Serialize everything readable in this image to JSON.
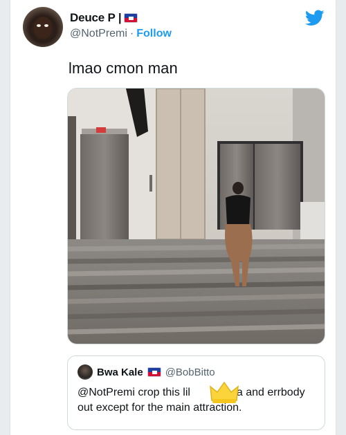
{
  "author": {
    "display_name": "Deuce P |",
    "handle": "@NotPremi",
    "separator": "·",
    "follow_label": "Follow"
  },
  "tweet": {
    "text": "lmao cmon man"
  },
  "quote": {
    "display_name": "Bwa Kale",
    "handle": "@BobBitto",
    "line1": "@NotPremi crop this lil",
    "line1_tail": "a and errbody",
    "line2": "out except for the main attraction."
  },
  "colors": {
    "accent": "#1d9bf0",
    "text": "#0f1419",
    "muted": "#536471",
    "flag_blue": "#1c3fa0",
    "flag_red": "#d21034",
    "crown": "#fbd33a"
  },
  "icons": [
    "twitter-bird-icon",
    "haiti-flag-icon",
    "crown-emoji-icon"
  ]
}
